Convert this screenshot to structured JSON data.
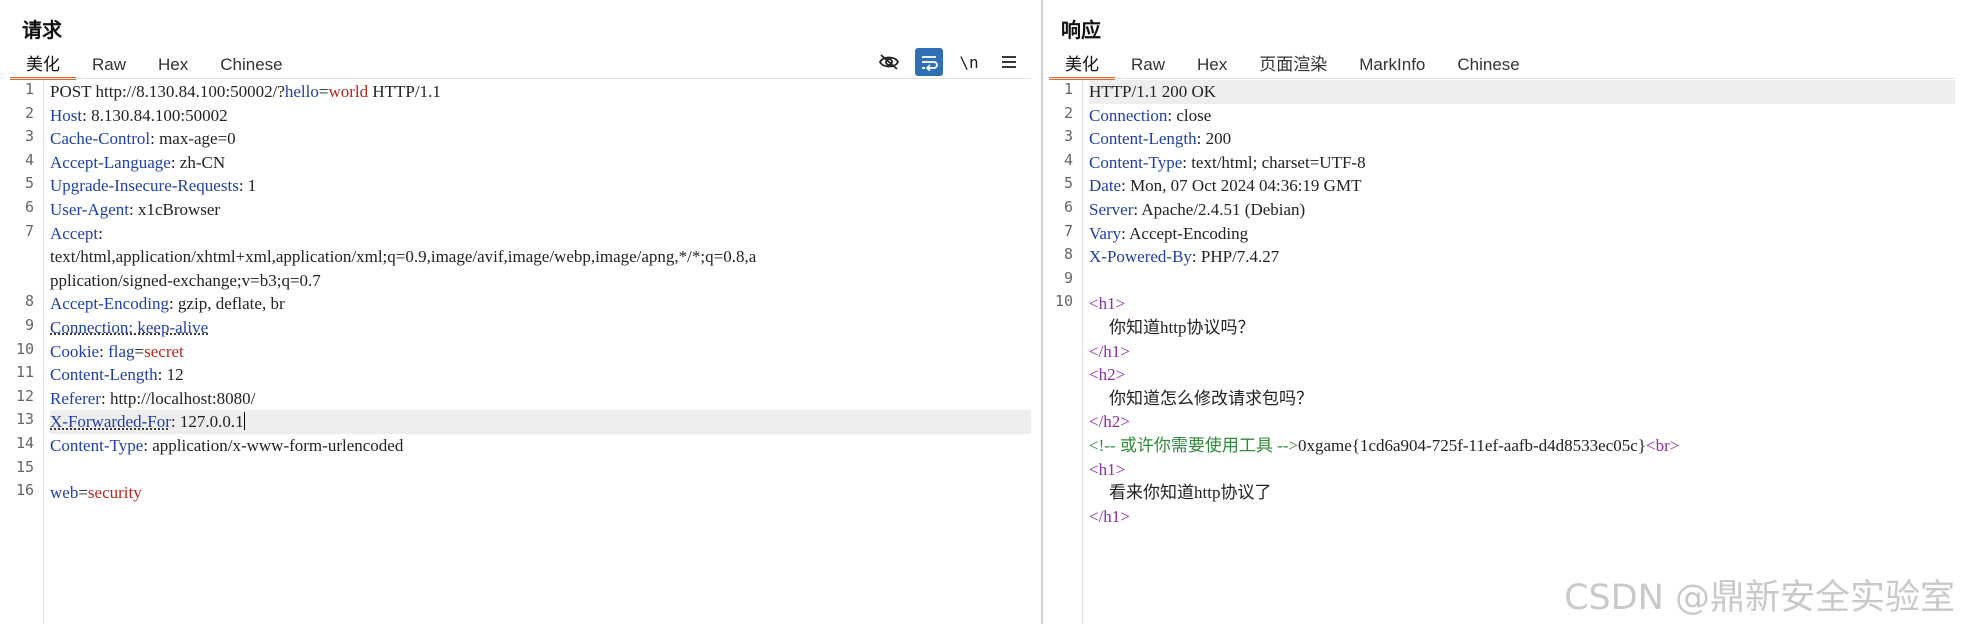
{
  "request": {
    "title": "请求",
    "tabs": [
      "美化",
      "Raw",
      "Hex",
      "Chinese"
    ],
    "active_tab": "美化",
    "toolbar": {
      "newline_label": "\\n"
    },
    "lines": {
      "l1": {
        "method": "POST ",
        "url_a": "http://8.130.84.100:50002/?",
        "param_key": "hello",
        "eq": "=",
        "param_val": "world",
        "protocol": " HTTP/1.1"
      },
      "l2": {
        "key": "Host",
        "value": ": 8.130.84.100:50002"
      },
      "l3": {
        "key": "Cache-Control",
        "value": ": max-age=0"
      },
      "l4": {
        "key": "Accept-Language",
        "value": ": zh-CN"
      },
      "l5": {
        "key": "Upgrade-Insecure-Requests",
        "value": ": 1"
      },
      "l6": {
        "key": "User-Agent",
        "value": ": x1cBrowser"
      },
      "l7": {
        "key": "Accept",
        "value": ":"
      },
      "l7_cont1": "text/html,application/xhtml+xml,application/xml;q=0.9,image/avif,image/webp,image/apng,*/*;q=0.8,a",
      "l7_cont2": "pplication/signed-exchange;v=b3;q=0.7",
      "l8": {
        "key": "Accept-Encoding",
        "value": ": gzip, deflate, br"
      },
      "l9": {
        "text": "Connection: keep-alive"
      },
      "l10": {
        "key": "Cookie",
        "sep": ": ",
        "cookie_key": "flag",
        "eq": "=",
        "cookie_val": "secret"
      },
      "l11": {
        "key": "Content-Length",
        "value": ": 12"
      },
      "l12": {
        "key": "Referer",
        "value": ": http://localhost:8080/"
      },
      "l13": {
        "key": "X-Forwarded-For",
        "value": ": 127.0.0.1"
      },
      "l14": {
        "key": "Content-Type",
        "value": ": application/x-www-form-urlencoded"
      },
      "l16": {
        "key": "web",
        "eq": "=",
        "val": "security"
      }
    },
    "line_numbers": [
      "1",
      "2",
      "3",
      "4",
      "5",
      "6",
      "7",
      "8",
      "9",
      "10",
      "11",
      "12",
      "13",
      "14",
      "15",
      "16"
    ]
  },
  "response": {
    "title": "响应",
    "tabs": [
      "美化",
      "Raw",
      "Hex",
      "页面渲染",
      "MarkInfo",
      "Chinese"
    ],
    "active_tab": "美化",
    "lines": {
      "l1": {
        "text": "HTTP/1.1 200 OK"
      },
      "l2": {
        "key": "Connection",
        "value": ": close"
      },
      "l3": {
        "key": "Content-Length",
        "value": ": 200"
      },
      "l4": {
        "key": "Content-Type",
        "value": ": text/html; charset=UTF-8"
      },
      "l5": {
        "key": "Date",
        "value": ": Mon, 07 Oct 2024 04:36:19 GMT"
      },
      "l6": {
        "key": "Server",
        "value": ": Apache/2.4.51 (Debian)"
      },
      "l7": {
        "key": "Vary",
        "value": ": Accept-Encoding"
      },
      "l8": {
        "key": "X-Powered-By",
        "value": ": PHP/7.4.27"
      },
      "b1_open": "<h1>",
      "b1_text": "你知道http协议吗？",
      "b1_close": "</h1>",
      "b2_open": "<h2>",
      "b2_text": "你知道怎么修改请求包吗？",
      "b2_close": "</h2>",
      "b3_comment": "<!-- 或许你需要使用工具 -->",
      "b3_flag": "0xgame{1cd6a904-725f-11ef-aafb-d4d8533ec05c}",
      "b3_br": "<br>",
      "b4_open": "<h1>",
      "b4_text": "看来你知道http协议了",
      "b4_close": "</h1>"
    },
    "line_numbers": [
      "1",
      "2",
      "3",
      "4",
      "5",
      "6",
      "7",
      "8",
      "9",
      "10"
    ]
  },
  "watermark": "CSDN @鼎新安全实验室"
}
